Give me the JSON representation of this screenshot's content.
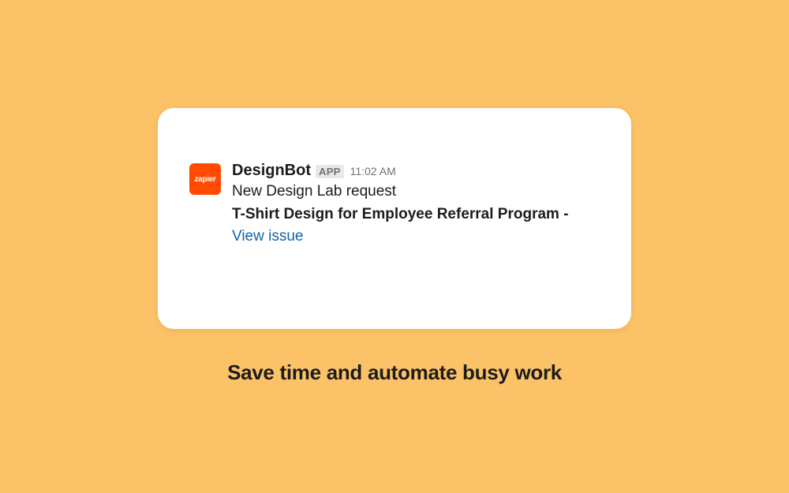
{
  "card": {
    "avatar_label": "zapier",
    "bot_name": "DesignBot",
    "app_badge": "APP",
    "timestamp": "11:02 AM",
    "message_text": "New Design Lab request",
    "message_title": "T-Shirt Design for Employee Referral Program -",
    "link_text": "View issue"
  },
  "tagline": "Save time and automate busy work",
  "colors": {
    "background": "#fcc267",
    "avatar_bg": "#ff4a00",
    "link": "#1264a3"
  }
}
